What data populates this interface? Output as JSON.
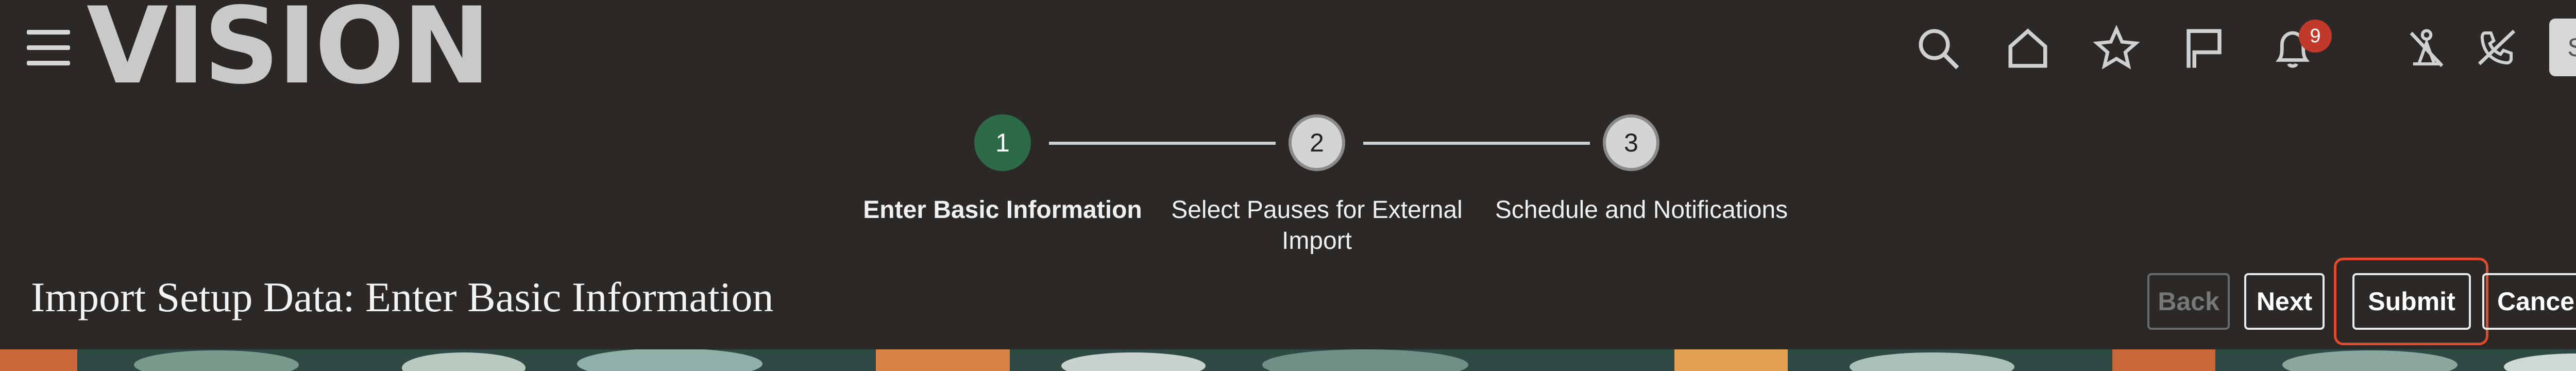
{
  "header": {
    "logo_text": "VISION",
    "notification_count": "9",
    "avatar_initials": "SI"
  },
  "icons": [
    "menu-icon",
    "search-icon",
    "home-icon",
    "favorites-star-icon",
    "flag-icon",
    "notifications-bell-icon",
    "accessibility-off-icon",
    "phone-off-icon"
  ],
  "train": {
    "steps": [
      {
        "number": "1",
        "label": "Enter Basic Information",
        "state": "active"
      },
      {
        "number": "2",
        "label": "Select Pauses for External Import",
        "state": "future"
      },
      {
        "number": "3",
        "label": "Schedule and Notifications",
        "state": "future"
      }
    ]
  },
  "page": {
    "title": "Import Setup Data: Enter Basic Information"
  },
  "buttons": {
    "back": "Back",
    "next": "Next",
    "submit": "Submit",
    "cancel": "Cancel"
  },
  "colors": {
    "background": "#2b2826",
    "active_step": "#2d6a48",
    "badge": "#c0392b",
    "focus": "#e04a2f"
  }
}
